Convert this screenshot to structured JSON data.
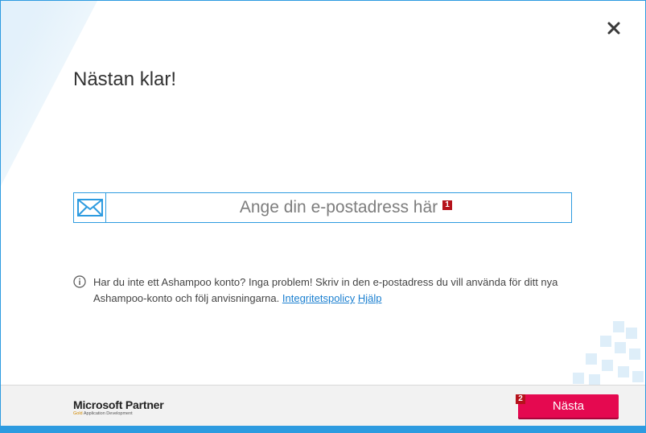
{
  "dialog": {
    "title": "Nästan klar!",
    "close_icon": "close-icon"
  },
  "email": {
    "icon": "envelope-icon",
    "placeholder": "Ange din e-postadress här",
    "value": ""
  },
  "markers": {
    "m1": "1",
    "m2": "2"
  },
  "info": {
    "icon": "info-icon",
    "text": "Har du inte ett Ashampoo konto? Inga problem! Skriv in den e-postadress du vill använda för ditt nya Ashampoo-konto och följ anvisningarna.",
    "privacy_link": "Integritetspolicy",
    "help_link": "Hjälp"
  },
  "footer": {
    "partner_name": "Microsoft Partner",
    "partner_level": "Gold",
    "partner_sub": "Application Development",
    "next_label": "Nästa"
  },
  "colors": {
    "accent": "#2d9be0",
    "next_button": "#e50950",
    "marker": "#b5121b"
  }
}
